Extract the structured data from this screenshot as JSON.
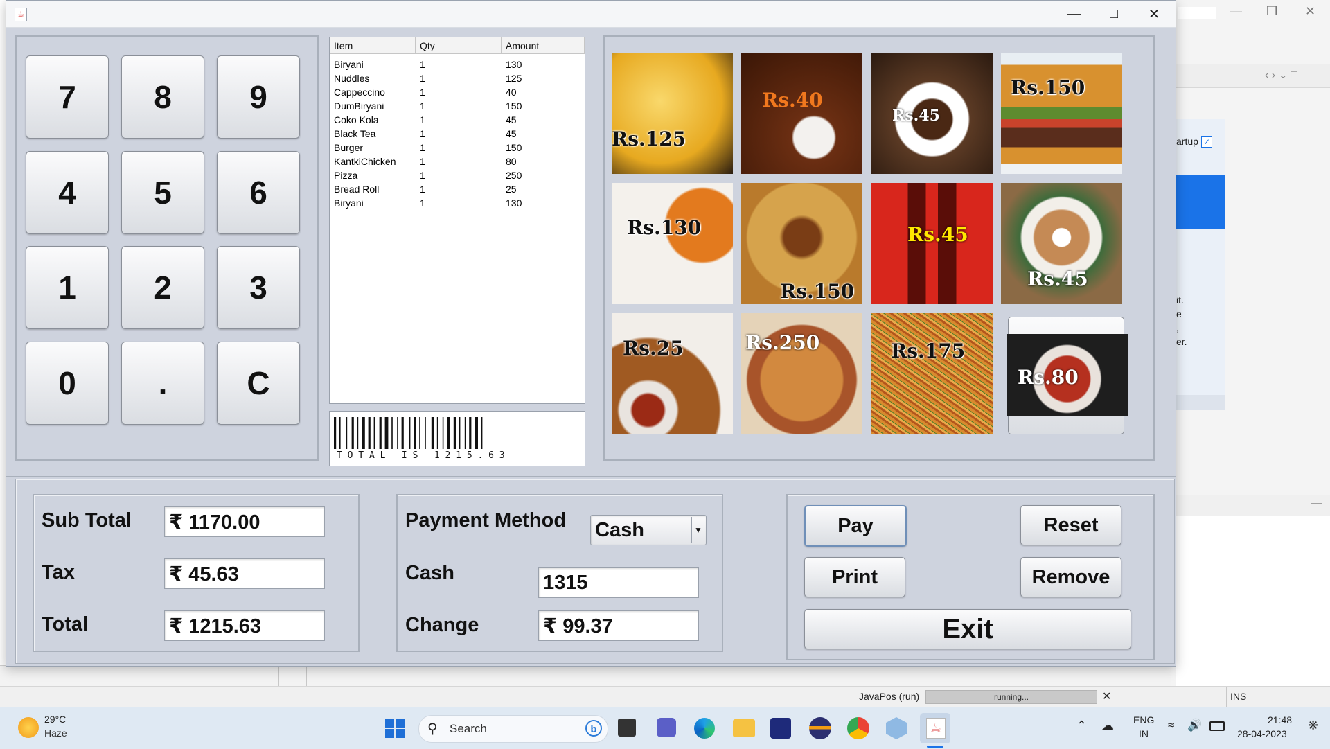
{
  "keypad": {
    "keys": [
      "7",
      "8",
      "9",
      "4",
      "5",
      "6",
      "1",
      "2",
      "3",
      "0",
      ".",
      "C"
    ]
  },
  "order": {
    "columns": [
      "Item",
      "Qty",
      "Amount"
    ],
    "rows": [
      [
        "Biryani",
        "1",
        "130"
      ],
      [
        "Nuddles",
        "1",
        "125"
      ],
      [
        "Cappeccino",
        "1",
        "40"
      ],
      [
        "DumBiryani",
        "1",
        "150"
      ],
      [
        "Coko Kola",
        "1",
        "45"
      ],
      [
        "Black Tea",
        "1",
        "45"
      ],
      [
        "Burger",
        "1",
        "150"
      ],
      [
        "KantkiChicken",
        "1",
        "80"
      ],
      [
        "Pizza",
        "1",
        "250"
      ],
      [
        "Bread Roll",
        "1",
        "25"
      ],
      [
        "Biryani",
        "1",
        "130"
      ]
    ]
  },
  "barcode": {
    "text": "T O T A L   I S   1 2 1 5 . 6 3"
  },
  "menu": {
    "items": [
      {
        "price": "Rs.125",
        "icon": "noodles-image"
      },
      {
        "price": "Rs.40",
        "icon": "tea-cup-image"
      },
      {
        "price": "Rs.45",
        "icon": "coffee-cup-image"
      },
      {
        "price": "Rs.150",
        "icon": "burger-image"
      },
      {
        "price": "Rs.130",
        "icon": "biryani-plate-image"
      },
      {
        "price": "Rs.150",
        "icon": "dum-biryani-image"
      },
      {
        "price": "Rs.45",
        "icon": "cola-bottles-image"
      },
      {
        "price": "Rs.45",
        "icon": "cappuccino-image"
      },
      {
        "price": "Rs.25",
        "icon": "bread-roll-image"
      },
      {
        "price": "Rs.250",
        "icon": "pizza-image"
      },
      {
        "price": "Rs.175",
        "icon": "hakka-noodles-image"
      },
      {
        "price": "Rs.80",
        "icon": "chicken-image"
      }
    ]
  },
  "summary": {
    "subtotal_label": "Sub Total",
    "subtotal_value": "₹ 1170.00",
    "tax_label": "Tax",
    "tax_value": "₹ 45.63",
    "total_label": "Total",
    "total_value": "₹ 1215.63"
  },
  "payment": {
    "method_label": "Payment Method",
    "method_value": "Cash",
    "cash_label": "Cash",
    "cash_value": "1315",
    "change_label": "Change",
    "change_value": "₹ 99.37"
  },
  "actions": {
    "pay": "Pay",
    "reset": "Reset",
    "print": "Print",
    "remove": "Remove",
    "exit": "Exit"
  },
  "background": {
    "snippet_1": "artup",
    "snippet_2": "it.",
    "snippet_3": "e",
    "snippet_4": ",",
    "snippet_5": "er."
  },
  "status": {
    "project": "JavaPos (run)",
    "progress": "running...",
    "mode": "INS"
  },
  "taskbar": {
    "weather_temp": "29°C",
    "weather_desc": "Haze",
    "search_placeholder": "Search",
    "lang_1": "ENG",
    "lang_2": "IN",
    "time": "21:48",
    "date": "28-04-2023"
  },
  "colors": {
    "panel": "#ced3de",
    "accent": "#1a73e8"
  }
}
